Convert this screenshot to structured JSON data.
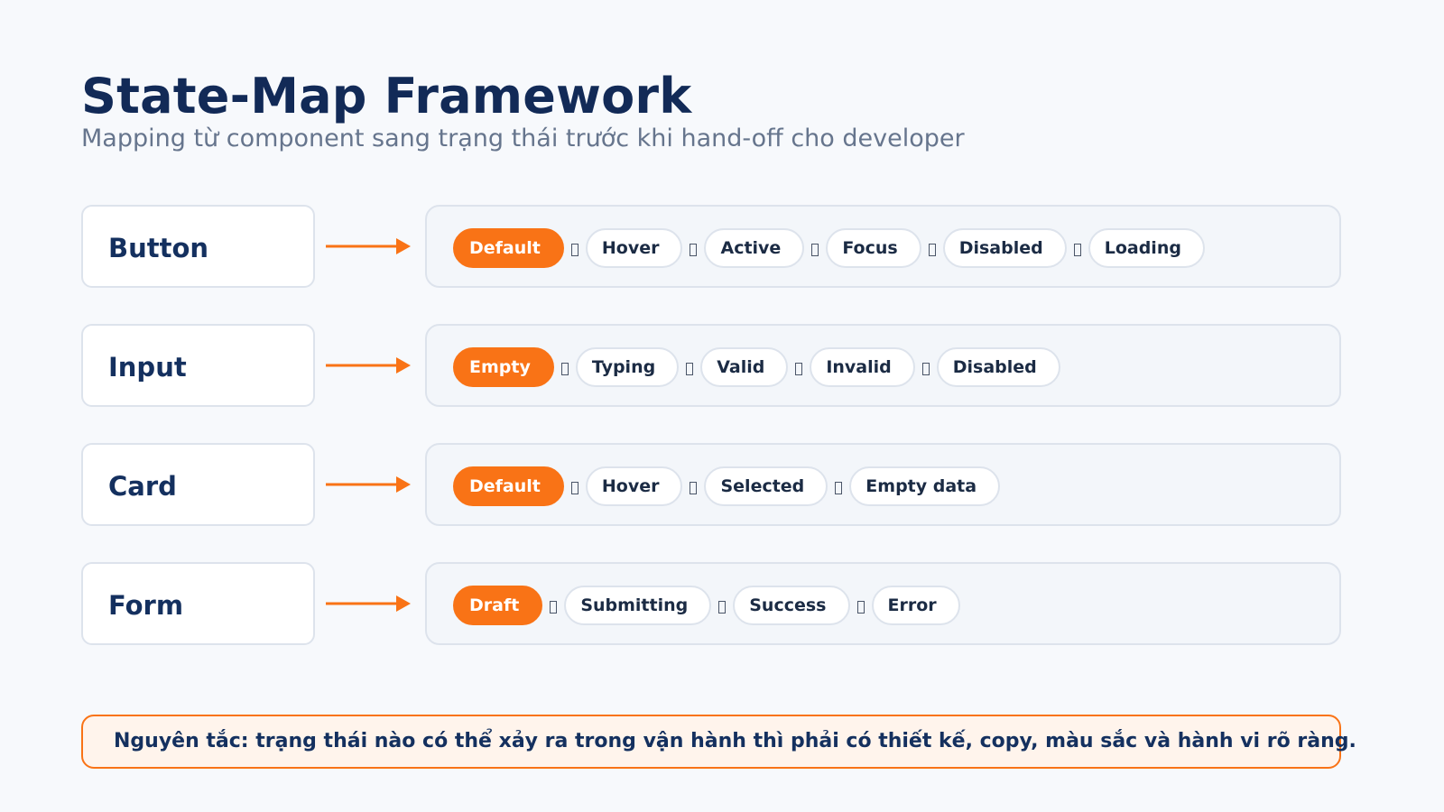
{
  "header": {
    "title": "State-Map Framework",
    "subtitle": "Mapping từ component sang trạng thái trước khi hand-off cho developer"
  },
  "rows": [
    {
      "component": "Button",
      "states": [
        "Default",
        "Hover",
        "Active",
        "Focus",
        "Disabled",
        "Loading"
      ]
    },
    {
      "component": "Input",
      "states": [
        "Empty",
        "Typing",
        "Valid",
        "Invalid",
        "Disabled"
      ]
    },
    {
      "component": "Card",
      "states": [
        "Default",
        "Hover",
        "Selected",
        "Empty data"
      ]
    },
    {
      "component": "Form",
      "states": [
        "Draft",
        "Submitting",
        "Success",
        "Error"
      ]
    }
  ],
  "principle": {
    "text": "Nguyên tắc: trạng thái nào có thể xảy ra trong vận hành thì phải có thiết kế, copy, màu sắc và hành vi rõ ràng."
  },
  "colors": {
    "accent": "#f97316",
    "title": "#122a57",
    "subtitle": "#66758d",
    "background": "#f7f9fc"
  },
  "icons": {
    "arrow": "arrow-right-icon",
    "separator": "missing-glyph-icon"
  }
}
